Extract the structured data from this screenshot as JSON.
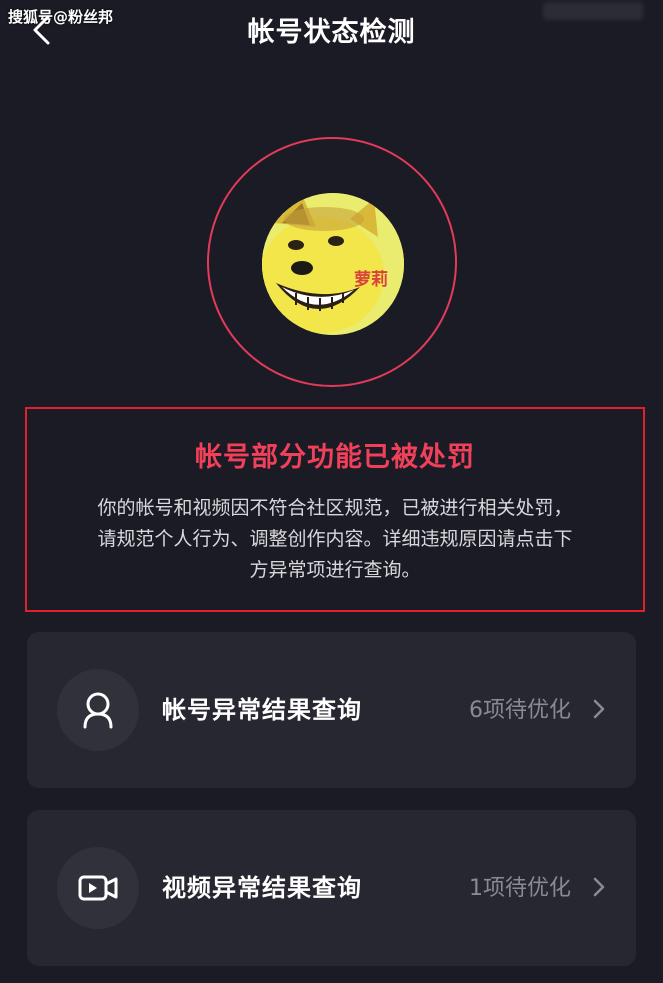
{
  "watermark": "搜狐号@粉丝邦",
  "header": {
    "title": "帐号状态检测",
    "back_icon": "chevron-left-icon"
  },
  "avatar": {
    "tag": "萝莉",
    "ring_color": "#e23b5a"
  },
  "penalty": {
    "title": "帐号部分功能已被处罚",
    "description_lines": [
      "你的帐号和视频因不符合社区规范，已被进行相关处罚，",
      "请规范个人行为、调整创作内容。详细违规原因请点击下",
      "方异常项进行查询。"
    ],
    "title_color": "#f1405a",
    "border_color": "#e0212c"
  },
  "rows": [
    {
      "icon": "user-icon",
      "label": "帐号异常结果查询",
      "status": "6项待优化",
      "chevron": "chevron-right-icon"
    },
    {
      "icon": "video-icon",
      "label": "视频异常结果查询",
      "status": "1项待优化",
      "chevron": "chevron-right-icon"
    }
  ]
}
